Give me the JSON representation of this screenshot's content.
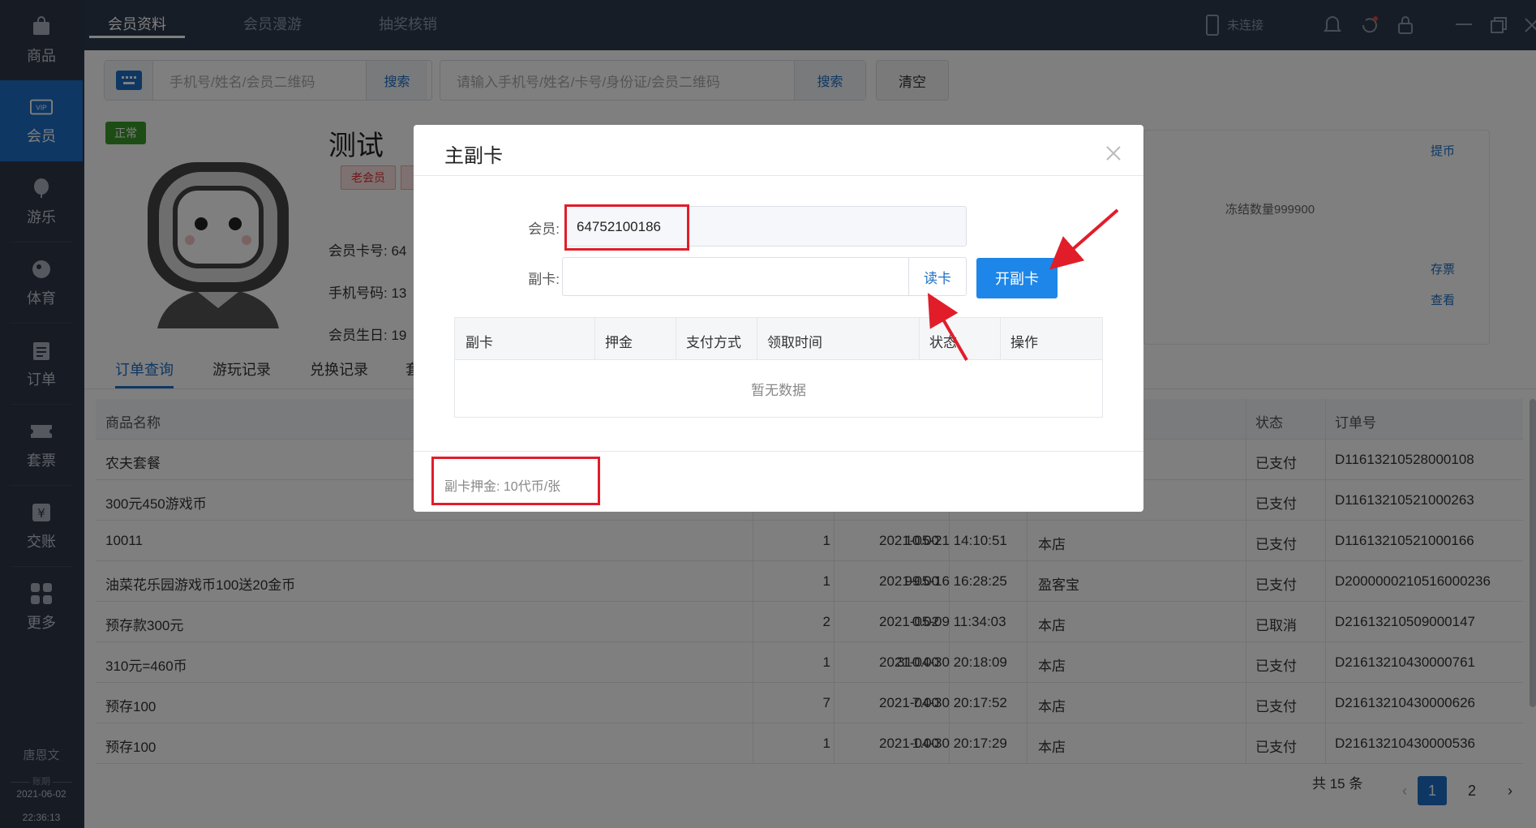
{
  "sidebar": {
    "items": [
      {
        "label": "商品",
        "icon": "bag-icon"
      },
      {
        "label": "会员",
        "icon": "vip-icon"
      },
      {
        "label": "游乐",
        "icon": "balloon-icon"
      },
      {
        "label": "体育",
        "icon": "ball-icon"
      },
      {
        "label": "订单",
        "icon": "clipboard-icon"
      },
      {
        "label": "套票",
        "icon": "ticket-icon"
      },
      {
        "label": "交账",
        "icon": "yen-icon"
      },
      {
        "label": "更多",
        "icon": "grid-icon"
      }
    ],
    "user": "唐恩文",
    "period_label": "账期",
    "date": "2021-06-02",
    "time": "22:36:13"
  },
  "topbar": {
    "tabs": [
      "会员资料",
      "会员漫游",
      "抽奖核销"
    ],
    "device_status": "未连接"
  },
  "search": {
    "left_placeholder": "手机号/姓名/会员二维码",
    "left_button": "搜索",
    "right_placeholder": "请输入手机号/姓名/卡号/身份证/会员二维码",
    "right_button": "搜索",
    "clear_button": "清空"
  },
  "member": {
    "status": "正常",
    "name": "测试",
    "badge": "老会员",
    "card_no_label": "会员卡号: 64",
    "phone_label": "手机号码: 13",
    "birthday_label": "会员生日: 19"
  },
  "right_panel": {
    "link1": "提币",
    "frozen": "冻结数量999900",
    "link2": "存票",
    "link3": "查看"
  },
  "sub_tabs": [
    "订单查询",
    "游玩记录",
    "兑换记录",
    "套"
  ],
  "orders": {
    "headers": {
      "name": "商品名称",
      "status": "状态",
      "order_no": "订单号"
    },
    "rows": [
      {
        "name": "农夫套餐",
        "qty": "",
        "amount": "",
        "time": "",
        "store": "",
        "status": "已支付",
        "order_no": "D11613210528000108"
      },
      {
        "name": "300元450游戏币",
        "qty": "",
        "amount": "",
        "time": "",
        "store": "",
        "status": "已支付",
        "order_no": "D11613210521000263"
      },
      {
        "name": "10011",
        "qty": "1",
        "amount": "10.00",
        "time": "2021-05-21 14:10:51",
        "store": "本店",
        "status": "已支付",
        "order_no": "D11613210521000166"
      },
      {
        "name": "油菜花乐园游戏币100送20金币",
        "qty": "1",
        "amount": "99.00",
        "time": "2021-05-16 16:28:25",
        "store": "盈客宝",
        "status": "已支付",
        "order_no": "D2000000210516000236"
      },
      {
        "name": "预存款300元",
        "qty": "2",
        "amount": "0.02",
        "time": "2021-05-09 11:34:03",
        "store": "本店",
        "status": "已取消",
        "order_no": "D21613210509000147"
      },
      {
        "name": "310元=460币",
        "qty": "1",
        "amount": "310.00",
        "time": "2021-04-30 20:18:09",
        "store": "本店",
        "status": "已支付",
        "order_no": "D21613210430000761"
      },
      {
        "name": "预存100",
        "qty": "7",
        "amount": "7.00",
        "time": "2021-04-30 20:17:52",
        "store": "本店",
        "status": "已支付",
        "order_no": "D21613210430000626"
      },
      {
        "name": "预存100",
        "qty": "1",
        "amount": "1.00",
        "time": "2021-04-30 20:17:29",
        "store": "本店",
        "status": "已支付",
        "order_no": "D21613210430000536"
      }
    ]
  },
  "pagination": {
    "total": "共 15 条",
    "pages": [
      "1",
      "2"
    ]
  },
  "modal": {
    "title": "主副卡",
    "member_label": "会员:",
    "member_value": "64752100186",
    "card_label": "副卡:",
    "read_button": "读卡",
    "open_button": "开副卡",
    "table_headers": [
      "副卡",
      "押金",
      "支付方式",
      "领取时间",
      "状态",
      "操作"
    ],
    "empty_text": "暂无数据",
    "deposit_note": "副卡押金: 10代币/张"
  },
  "colors": {
    "accent": "#1d6fc6",
    "highlight": "#e11d2a",
    "sidebar": "#2c3649"
  }
}
